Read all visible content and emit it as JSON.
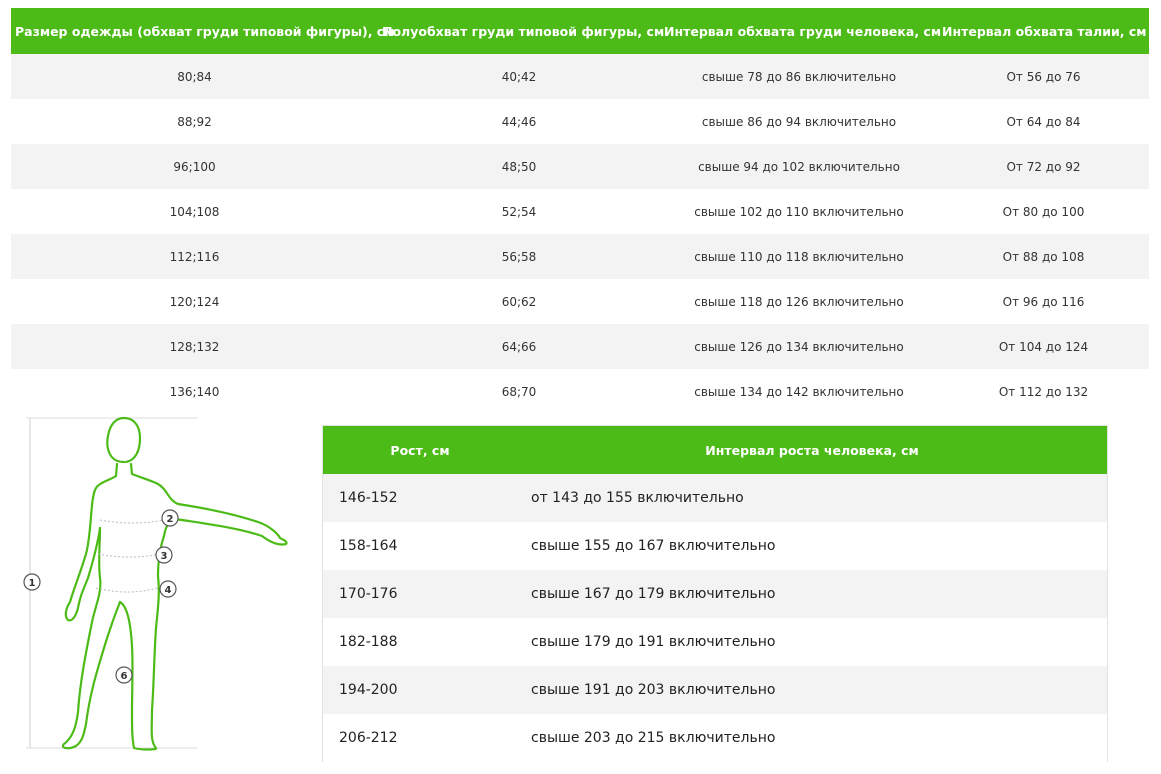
{
  "size_table": {
    "headers": [
      "Размер одежды (обхват груди типовой фигуры), см",
      "Полуобхват груди типовой фигуры, см",
      "Интервал обхвата груди человека, см",
      "Интервал обхвата талии, см"
    ],
    "rows": [
      [
        "80;84",
        "40;42",
        "свыше 78 до 86 включительно",
        "От 56 до 76"
      ],
      [
        "88;92",
        "44;46",
        "свыше 86 до 94 включительно",
        "От 64 до 84"
      ],
      [
        "96;100",
        "48;50",
        "свыше 94 до 102 включительно",
        "От 72 до 92"
      ],
      [
        "104;108",
        "52;54",
        "свыше 102 до 110 включительно",
        "От 80 до 100"
      ],
      [
        "112;116",
        "56;58",
        "свыше 110 до 118 включительно",
        "От 88 до 108"
      ],
      [
        "120;124",
        "60;62",
        "свыше 118 до 126 включительно",
        "От 96 до 116"
      ],
      [
        "128;132",
        "64;66",
        "свыше 126 до 134 включительно",
        "От 104 до 124"
      ],
      [
        "136;140",
        "68;70",
        "свыше 134 до 142 включительно",
        "От 112 до 132"
      ]
    ]
  },
  "height_table": {
    "headers": [
      "Рост, см",
      "Интервал роста человека, см"
    ],
    "rows": [
      [
        "146-152",
        "от 143 до 155 включительно"
      ],
      [
        "158-164",
        "свыше 155 до 167 включительно"
      ],
      [
        "170-176",
        "свыше 167 до 179 включительно"
      ],
      [
        "182-188",
        "свыше 179 до 191 включительно"
      ],
      [
        "194-200",
        "свыше 191 до 203 включительно"
      ],
      [
        "206-212",
        "свыше 203 до 215 включительно"
      ]
    ]
  },
  "figure": {
    "markers": [
      "1",
      "2",
      "3",
      "4",
      "6"
    ]
  },
  "colors": {
    "accent": "#4cbb17",
    "stripe": "#f3f3f3"
  }
}
